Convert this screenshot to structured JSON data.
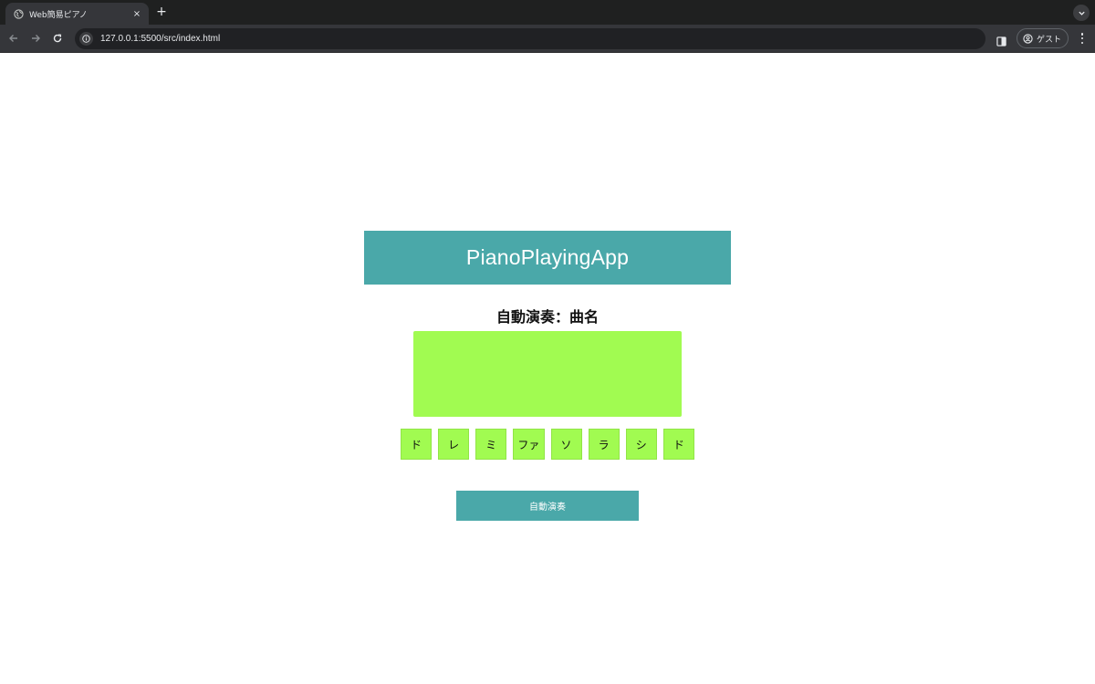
{
  "browser": {
    "tab_title": "Web簡易ピアノ",
    "tab_close": "×",
    "new_tab": "+",
    "url": "127.0.0.1:5500/src/index.html",
    "profile_label": "ゲスト"
  },
  "app": {
    "title": "PianoPlayingApp",
    "song_title": "自動演奏：曲名",
    "keys": [
      "ド",
      "レ",
      "ミ",
      "ファ",
      "ソ",
      "ラ",
      "シ",
      "ド"
    ],
    "auto_play_label": "自動演奏"
  },
  "colors": {
    "header_teal": "#4aa8a9",
    "key_green": "#a1fb51"
  }
}
